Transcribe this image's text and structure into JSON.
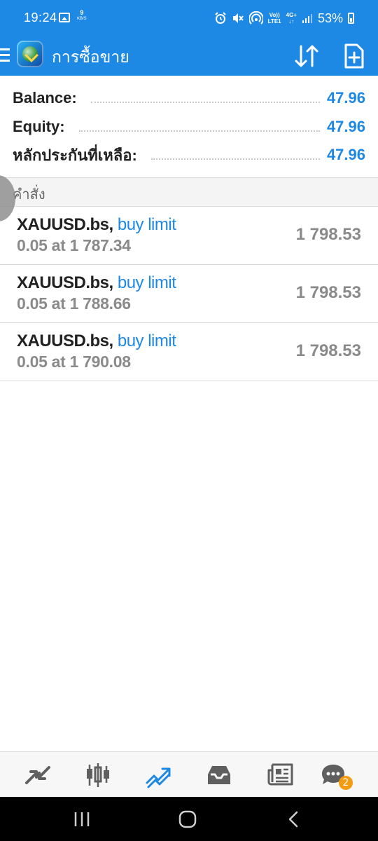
{
  "status_bar": {
    "time": "19:24",
    "data_speed": "9",
    "data_unit": "KB/S",
    "volte": "Vo))",
    "lte": "LTE1",
    "network": "4G+",
    "battery": "53%"
  },
  "toolbar": {
    "title": "การซื้อขาย"
  },
  "account": {
    "balance_label": "Balance:",
    "balance_value": "47.96",
    "equity_label": "Equity:",
    "equity_value": "47.96",
    "free_margin_label": "หลักประกันที่เหลือ:",
    "free_margin_value": "47.96"
  },
  "orders_section": {
    "title": "คำสั่ง"
  },
  "orders": [
    {
      "symbol": "XAUUSD.bs,",
      "type": "buy limit",
      "detail": "0.05 at 1 787.34",
      "price": "1 798.53"
    },
    {
      "symbol": "XAUUSD.bs,",
      "type": "buy limit",
      "detail": "0.05 at 1 788.66",
      "price": "1 798.53"
    },
    {
      "symbol": "XAUUSD.bs,",
      "type": "buy limit",
      "detail": "0.05 at 1 790.08",
      "price": "1 798.53"
    }
  ],
  "bottom_nav": {
    "items": [
      "quotes-icon",
      "chart-icon",
      "trade-icon",
      "history-icon",
      "news-icon",
      "chat-icon"
    ],
    "active": "trade-icon",
    "chat_badge": "2"
  },
  "colors": {
    "accent": "#1e88e5",
    "badge": "#f39c12",
    "muted_text": "#8a8a8a"
  }
}
